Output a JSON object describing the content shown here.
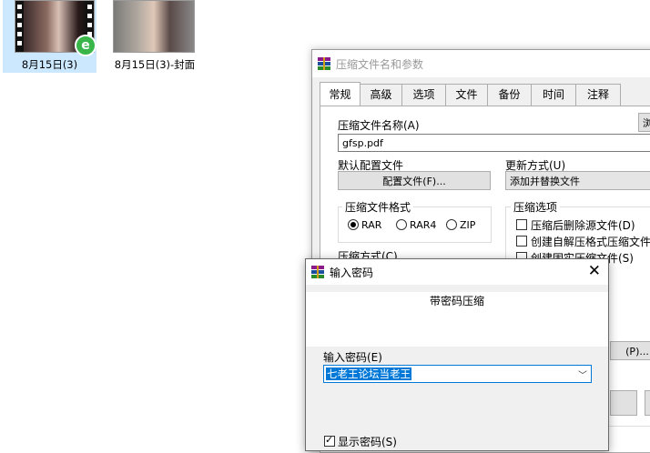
{
  "desktop": {
    "files": [
      {
        "name": "8月15日(3)"
      },
      {
        "name": "8月15日(3)-封面"
      }
    ]
  },
  "main_dialog": {
    "title": "压缩文件名和参数",
    "tabs": [
      "常规",
      "高级",
      "选项",
      "文件",
      "备份",
      "时间",
      "注释"
    ],
    "archive_name_label": "压缩文件名称(A)",
    "archive_name_value": "gfsp.pdf",
    "browse_label": "浏",
    "profile_label": "默认配置文件",
    "profile_button": "配置文件(F)...",
    "update_label": "更新方式(U)",
    "update_value": "添加并替换文件",
    "format_group": "压缩文件格式",
    "formats": [
      "RAR",
      "RAR4",
      "ZIP"
    ],
    "selected_format": "RAR",
    "method_label": "压缩方式(C)",
    "options_group": "压缩选项",
    "options": [
      "压缩后删除源文件(D)",
      "创建自解压格式压缩文件",
      "创建固实压缩文件(S)"
    ],
    "partial_button": "(P)..."
  },
  "password_dialog": {
    "title": "输入密码",
    "heading": "带密码压缩",
    "password_label": "输入密码(E)",
    "password_value": "七老王论坛当老王",
    "show_password_label": "显示密码(S)",
    "show_password_checked": true
  }
}
